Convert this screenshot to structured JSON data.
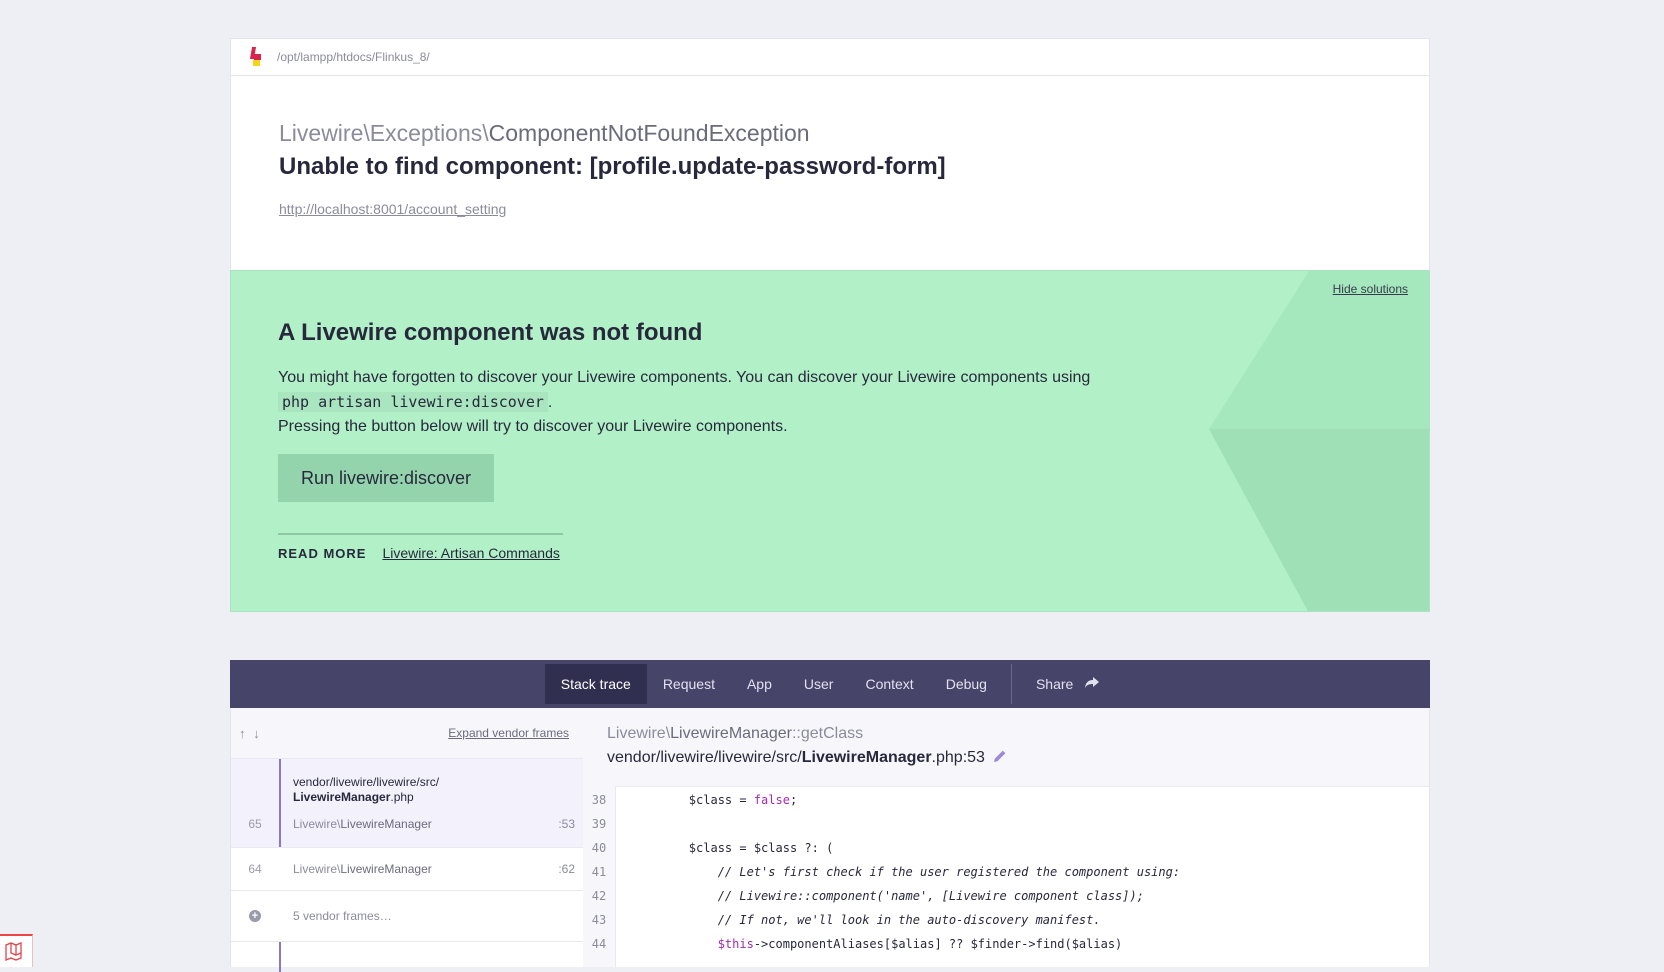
{
  "topbar": {
    "path": "/opt/lampp/htdocs/Flinkus_8/"
  },
  "exception": {
    "namespace": "Livewire\\Exceptions\\",
    "class": "ComponentNotFoundException",
    "message": "Unable to find component: [profile.update-password-form]",
    "url": "http://localhost:8001/account_setting"
  },
  "solution": {
    "hide_label": "Hide solutions",
    "title": "A Livewire component was not found",
    "desc_line1": "You might have forgotten to discover your Livewire components. You can discover your Livewire components using",
    "desc_code": "php artisan livewire:discover",
    "desc_end": ".",
    "desc_line2": "Pressing the button below will try to discover your Livewire components.",
    "button_label": "Run livewire:discover",
    "read_more_label": "READ MORE",
    "read_more_link": "Livewire: Artisan Commands"
  },
  "tabs": [
    {
      "label": "Stack trace",
      "active": true
    },
    {
      "label": "Request"
    },
    {
      "label": "App"
    },
    {
      "label": "User"
    },
    {
      "label": "Context"
    },
    {
      "label": "Debug"
    }
  ],
  "share_label": "Share",
  "frames_panel": {
    "arrows": "↑ ↓",
    "expand_label": "Expand vendor frames",
    "frames": [
      {
        "num": "65",
        "file_dir": "vendor/livewire/livewire/src/",
        "file_name": "LivewireManager",
        "file_ext": ".php",
        "ns": "Livewire\\",
        "cls": "LivewireManager",
        "line": ":53"
      },
      {
        "num": "64",
        "ns": "Livewire\\",
        "cls": "LivewireManager",
        "line": ":62"
      }
    ],
    "vendor_frames": "5 vendor frames…"
  },
  "code_panel": {
    "ns": "Livewire\\",
    "cls": "LivewireManager",
    "method": "::getClass",
    "file_dir": "vendor/livewire/livewire/src/",
    "file_name": "LivewireManager",
    "file_rest": ".php:53",
    "lines": [
      {
        "n": "38",
        "pre": "        $class = ",
        "kw": "false",
        "post": ";"
      },
      {
        "n": "39",
        "pre": ""
      },
      {
        "n": "40",
        "pre": "        $class = $class ?: ("
      },
      {
        "n": "41",
        "comment": "            // Let's first check if the user registered the component using:"
      },
      {
        "n": "42",
        "comment": "            // Livewire::component('name', [Livewire component class]);"
      },
      {
        "n": "43",
        "comment": "            // If not, we'll look in the auto-discovery manifest."
      },
      {
        "n": "44",
        "pre": "            ",
        "kw": "$this",
        "post": "->componentAliases[$alias] ?? $finder->find($alias)"
      }
    ]
  }
}
